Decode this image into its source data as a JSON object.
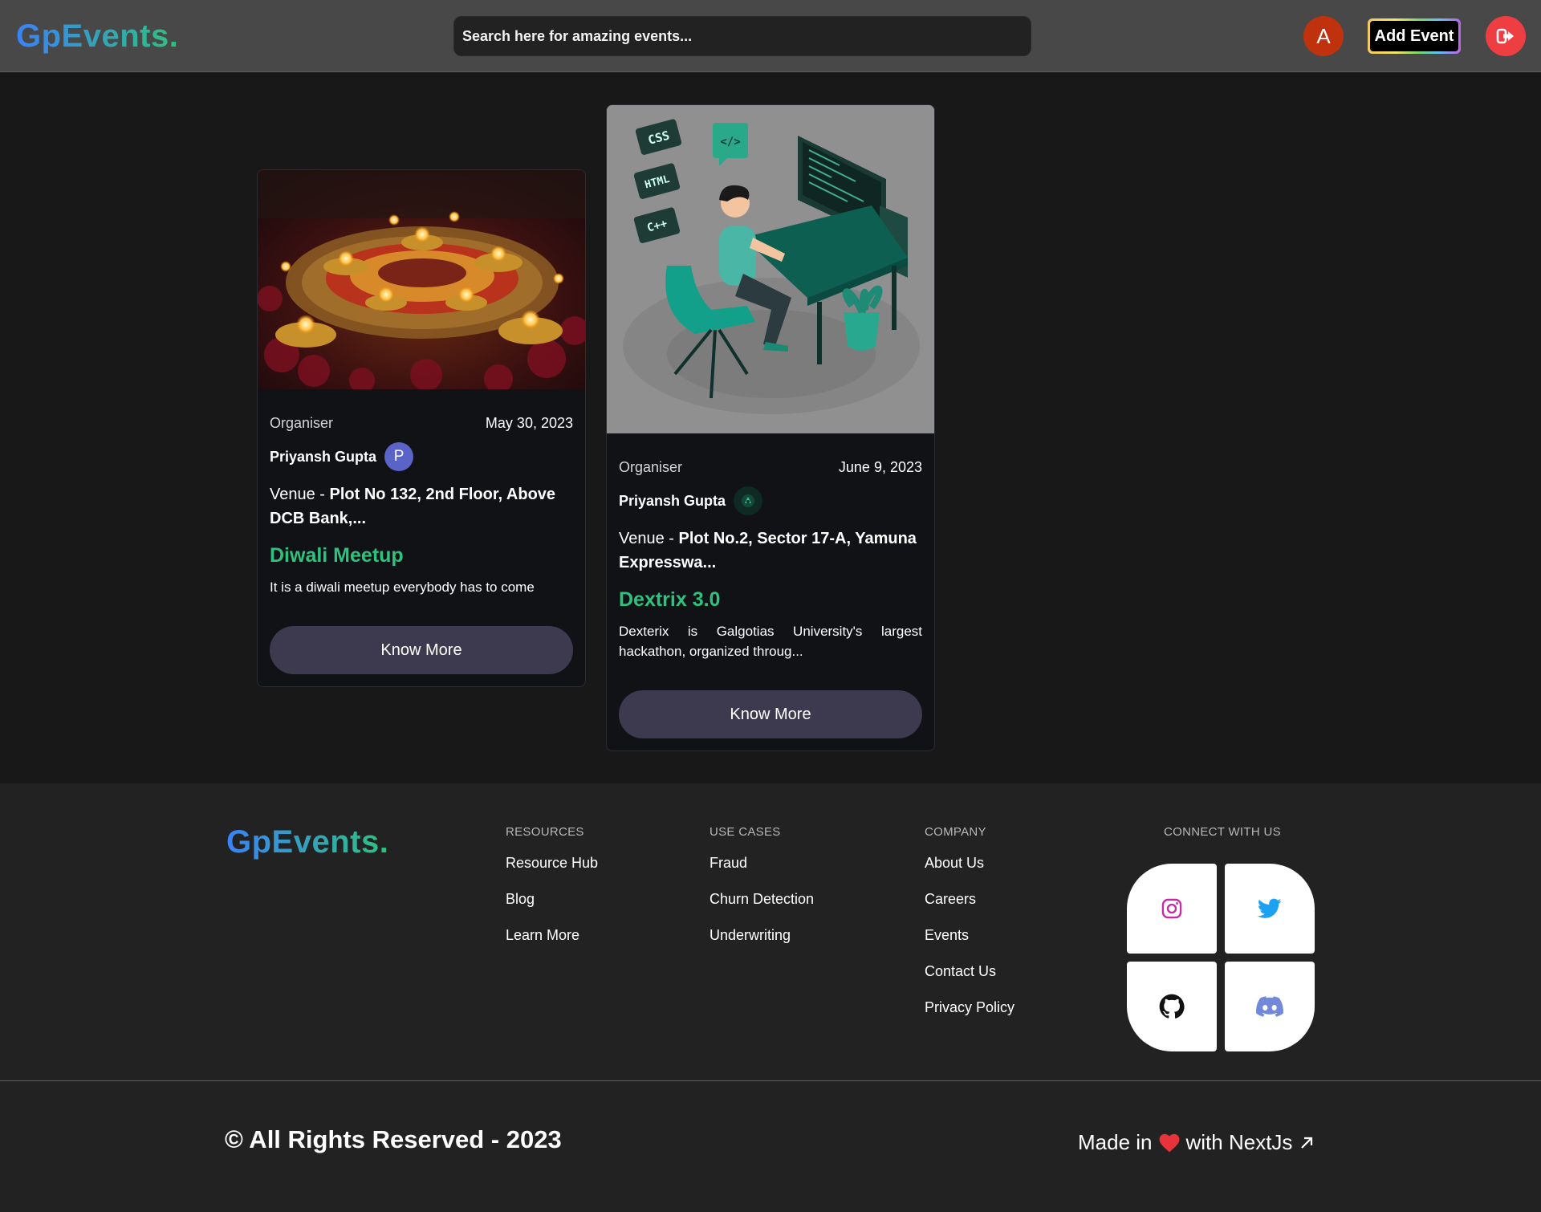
{
  "header": {
    "logo": "GpEvents.",
    "search_placeholder": "Search here for amazing events...",
    "avatar_letter": "A",
    "add_event_label": "Add Event"
  },
  "events": [
    {
      "organiser_label": "Organiser",
      "date": "May 30, 2023",
      "organiser_name": "Priyansh Gupta",
      "organiser_avatar": "P",
      "venue_prefix": "Venue - ",
      "venue": "Plot No 132, 2nd Floor, Above DCB Bank,...",
      "title": "Diwali Meetup",
      "description": "It is a diwali meetup everybody has to come",
      "button_label": "Know More"
    },
    {
      "organiser_label": "Organiser",
      "date": "June 9, 2023",
      "organiser_name": "Priyansh Gupta",
      "venue_prefix": "Venue - ",
      "venue": "Plot No.2, Sector 17-A, Yamuna Expresswa...",
      "title": "Dextrix 3.0",
      "description": "Dexterix is Galgotias University's largest hackathon, organized throug...",
      "button_label": "Know More",
      "image_tags": [
        "CSS",
        "HTML",
        "C++",
        "</>"
      ]
    }
  ],
  "footer": {
    "logo": "GpEvents.",
    "resources": {
      "heading": "RESOURCES",
      "links": [
        "Resource Hub",
        "Blog",
        "Learn More"
      ]
    },
    "use_cases": {
      "heading": "USE CASES",
      "links": [
        "Fraud",
        "Churn Detection",
        "Underwriting"
      ]
    },
    "company": {
      "heading": "COMPANY",
      "links": [
        "About Us",
        "Careers",
        "Events",
        "Contact Us",
        "Privacy Policy"
      ]
    },
    "connect": {
      "heading": "CONNECT WITH US",
      "icons": [
        "instagram-icon",
        "twitter-icon",
        "github-icon",
        "discord-icon"
      ]
    },
    "copyright": "© All Rights Reserved - 2023",
    "made_in_prefix": "Made in",
    "made_in_suffix": "with NextJs"
  },
  "colors": {
    "accent_green": "#2ec27e",
    "accent_blue": "#3b82f6",
    "logout_red": "#ef3e42",
    "button_bg": "#3d3a50"
  }
}
